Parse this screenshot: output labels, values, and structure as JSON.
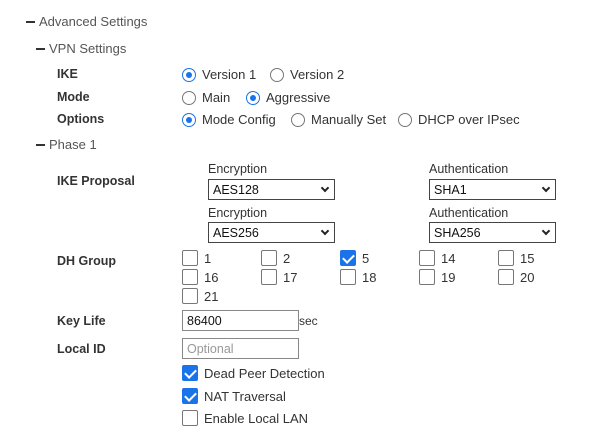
{
  "advanced": {
    "title": "Advanced Settings"
  },
  "vpn": {
    "title": "VPN Settings",
    "ike": {
      "label": "IKE",
      "options": [
        "Version 1",
        "Version 2"
      ],
      "selected": "Version 1"
    },
    "mode": {
      "label": "Mode",
      "options": [
        "Main",
        "Aggressive"
      ],
      "selected": "Aggressive"
    },
    "options": {
      "label": "Options",
      "options": [
        "Mode Config",
        "Manually Set",
        "DHCP over IPsec"
      ],
      "selected": "Mode Config"
    }
  },
  "phase1": {
    "title": "Phase 1",
    "ike_proposal": {
      "label": "IKE Proposal",
      "rows": [
        {
          "encryption_label": "Encryption",
          "encryption": "AES128",
          "authentication_label": "Authentication",
          "authentication": "SHA1"
        },
        {
          "encryption_label": "Encryption",
          "encryption": "AES256",
          "authentication_label": "Authentication",
          "authentication": "SHA256"
        }
      ]
    },
    "dh_group": {
      "label": "DH Group",
      "items": [
        {
          "value": "1",
          "checked": false
        },
        {
          "value": "2",
          "checked": false
        },
        {
          "value": "5",
          "checked": true
        },
        {
          "value": "14",
          "checked": false
        },
        {
          "value": "15",
          "checked": false
        },
        {
          "value": "16",
          "checked": false
        },
        {
          "value": "17",
          "checked": false
        },
        {
          "value": "18",
          "checked": false
        },
        {
          "value": "19",
          "checked": false
        },
        {
          "value": "20",
          "checked": false
        },
        {
          "value": "21",
          "checked": false
        }
      ]
    },
    "key_life": {
      "label": "Key Life",
      "value": "86400",
      "unit": "sec"
    },
    "local_id": {
      "label": "Local ID",
      "value": "",
      "placeholder": "Optional"
    },
    "dead_peer_detection": {
      "label": "Dead Peer Detection",
      "checked": true
    },
    "nat_traversal": {
      "label": "NAT Traversal",
      "checked": true
    },
    "enable_local_lan": {
      "label": "Enable Local LAN",
      "checked": false
    }
  },
  "colors": {
    "accent": "#1a73e8",
    "text": "#333333",
    "section": "#555555"
  }
}
